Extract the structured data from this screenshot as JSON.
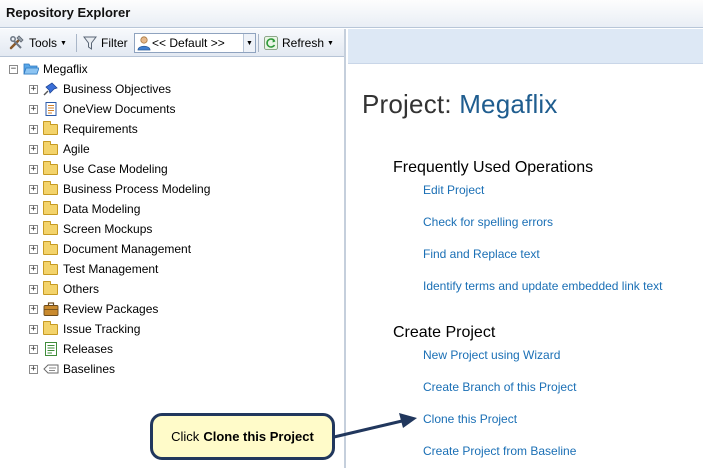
{
  "window": {
    "title": "Repository Explorer"
  },
  "toolbar": {
    "tools_label": "Tools",
    "filter_label": "Filter",
    "default_value": "<< Default >>",
    "refresh_label": "Refresh"
  },
  "tree": {
    "root": "Megaflix",
    "items": [
      {
        "label": "Business Objectives",
        "icon": "pin-icon"
      },
      {
        "label": "OneView Documents",
        "icon": "document-icon"
      },
      {
        "label": "Requirements",
        "icon": "folder-icon"
      },
      {
        "label": "Agile",
        "icon": "folder-icon"
      },
      {
        "label": "Use Case Modeling",
        "icon": "folder-icon"
      },
      {
        "label": "Business Process Modeling",
        "icon": "folder-icon"
      },
      {
        "label": "Data Modeling",
        "icon": "folder-icon"
      },
      {
        "label": "Screen Mockups",
        "icon": "folder-icon"
      },
      {
        "label": "Document Management",
        "icon": "folder-icon"
      },
      {
        "label": "Test Management",
        "icon": "folder-icon"
      },
      {
        "label": "Others",
        "icon": "folder-icon"
      },
      {
        "label": "Review Packages",
        "icon": "briefcase-icon"
      },
      {
        "label": "Issue Tracking",
        "icon": "folder-icon"
      },
      {
        "label": "Releases",
        "icon": "releases-icon"
      },
      {
        "label": "Baselines",
        "icon": "baseline-icon"
      }
    ]
  },
  "main": {
    "project_prefix": "Project:",
    "project_name": "Megaflix",
    "frequent": {
      "heading": "Frequently Used Operations",
      "links": [
        "Edit Project",
        "Check for spelling errors",
        "Find and Replace text",
        "Identify terms and update embedded link text"
      ]
    },
    "create": {
      "heading": "Create Project",
      "links": [
        "New Project using Wizard",
        "Create Branch of this Project",
        "Clone this Project",
        "Create Project from Baseline"
      ]
    }
  },
  "callout": {
    "prefix": "Click",
    "target": "Clone this Project"
  },
  "colors": {
    "link": "#1a6fb5",
    "callout_fill": "#fffbc9",
    "callout_border": "#21375d",
    "header_band": "#dde8f5"
  }
}
